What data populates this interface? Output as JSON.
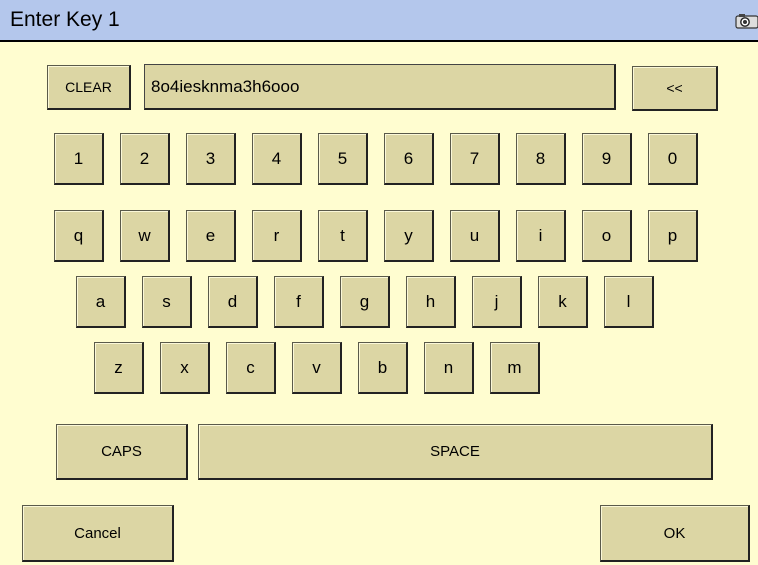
{
  "window": {
    "title": "Enter Key 1"
  },
  "toolbar": {
    "clear_label": "CLEAR",
    "backspace_label": "<<"
  },
  "input": {
    "value": "8o4iesknma3h6ooo"
  },
  "keyboard": {
    "row_digits": [
      "1",
      "2",
      "3",
      "4",
      "5",
      "6",
      "7",
      "8",
      "9",
      "0"
    ],
    "row_top": [
      "q",
      "w",
      "e",
      "r",
      "t",
      "y",
      "u",
      "i",
      "o",
      "p"
    ],
    "row_home": [
      "a",
      "s",
      "d",
      "f",
      "g",
      "h",
      "j",
      "k",
      "l"
    ],
    "row_bottom": [
      "z",
      "x",
      "c",
      "v",
      "b",
      "n",
      "m"
    ],
    "caps_label": "CAPS",
    "space_label": "SPACE"
  },
  "footer": {
    "cancel_label": "Cancel",
    "ok_label": "OK"
  },
  "colors": {
    "background": "#fffdd0",
    "titlebar": "#b4c7ec",
    "key_face": "#dcd6a4"
  },
  "icons": {
    "titlebar_icon": "camera-icon"
  }
}
